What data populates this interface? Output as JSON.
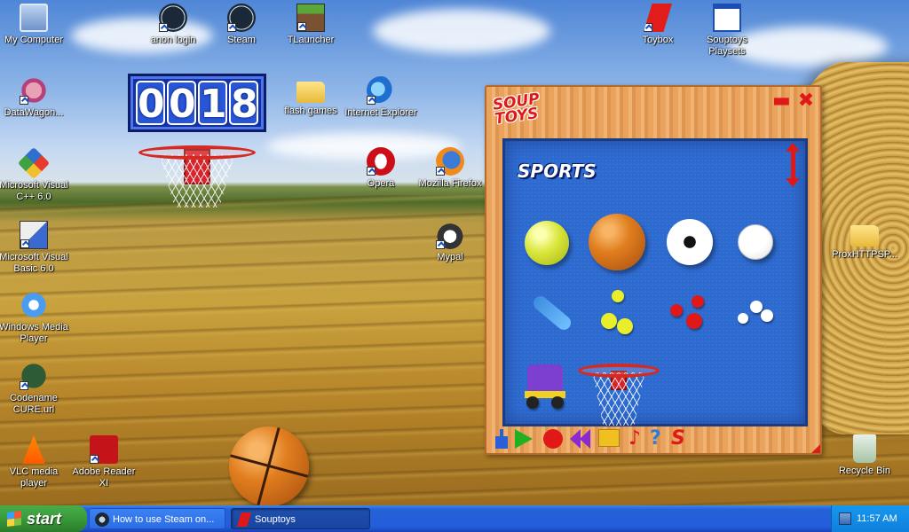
{
  "desktop": {
    "icons": [
      {
        "id": "my-computer",
        "label": "My Computer",
        "icon": "computer-icon"
      },
      {
        "id": "anon-login",
        "label": "anon login",
        "icon": "steam-icon"
      },
      {
        "id": "steam",
        "label": "Steam",
        "icon": "steam-icon"
      },
      {
        "id": "tlauncher",
        "label": "TLauncher",
        "icon": "minecraft-grass-icon"
      },
      {
        "id": "datawagon",
        "label": "DataWagon...",
        "icon": "datawagon-icon"
      },
      {
        "id": "flash-games",
        "label": "flash games",
        "icon": "folder-icon"
      },
      {
        "id": "internet-explorer",
        "label": "Internet Explorer",
        "icon": "internet-explorer-icon"
      },
      {
        "id": "visual-cpp",
        "label": "Microsoft Visual C++ 6.0",
        "icon": "visual-cpp-icon"
      },
      {
        "id": "opera",
        "label": "Opera",
        "icon": "opera-icon"
      },
      {
        "id": "firefox",
        "label": "Mozilla Firefox",
        "icon": "firefox-icon"
      },
      {
        "id": "visual-basic",
        "label": "Microsoft Visual Basic 6.0",
        "icon": "visual-basic-icon"
      },
      {
        "id": "mypal",
        "label": "Mypal",
        "icon": "mypal-icon"
      },
      {
        "id": "wmp",
        "label": "Windows Media Player",
        "icon": "media-player-icon"
      },
      {
        "id": "codename-cure",
        "label": "Codename CURE.url",
        "icon": "cure-icon"
      },
      {
        "id": "vlc",
        "label": "VLC media player",
        "icon": "vlc-cone-icon"
      },
      {
        "id": "adobe-reader",
        "label": "Adobe Reader XI",
        "icon": "adobe-reader-icon"
      },
      {
        "id": "toybox",
        "label": "Toybox",
        "icon": "souptoys-s-icon"
      },
      {
        "id": "souptoys-playsets",
        "label": "Souptoys Playsets",
        "icon": "window-icon"
      },
      {
        "id": "proxhttpsp",
        "label": "ProxHTTPSP...",
        "icon": "folder-icon"
      },
      {
        "id": "recycle-bin",
        "label": "Recycle Bin",
        "icon": "recycle-bin-icon"
      }
    ],
    "scoreboard_digits": [
      "0",
      "0",
      "1",
      "8"
    ]
  },
  "souptoys_window": {
    "logo": "SOUP TOYS",
    "minimize_symbol": "▬",
    "close_symbol": "✖",
    "category": "SPORTS",
    "toys": [
      {
        "name": "tennis-ball",
        "icon": "tennis-ball-icon"
      },
      {
        "name": "basketball",
        "icon": "basketball-icon"
      },
      {
        "name": "soccer-ball",
        "icon": "soccer-ball-icon"
      },
      {
        "name": "baseball",
        "icon": "baseball-icon"
      },
      {
        "name": "bat",
        "icon": "bat-icon"
      },
      {
        "name": "yellow-balls",
        "icon": "yellow-balls-icon"
      },
      {
        "name": "red-balls",
        "icon": "red-balls-icon"
      },
      {
        "name": "white-balls",
        "icon": "white-balls-icon"
      },
      {
        "name": "roller-skate",
        "icon": "roller-skate-icon"
      },
      {
        "name": "basketball-hoop",
        "icon": "basketball-hoop-icon"
      }
    ],
    "toolbar": [
      {
        "name": "blue-tool",
        "icon": "blue-jack-icon"
      },
      {
        "name": "play",
        "icon": "play-icon"
      },
      {
        "name": "record",
        "icon": "record-icon"
      },
      {
        "name": "rewind",
        "icon": "rewind-icon"
      },
      {
        "name": "yellow-square",
        "icon": "yellow-square-icon"
      },
      {
        "name": "music",
        "icon": "music-note-icon",
        "symbol": "♪"
      },
      {
        "name": "help",
        "icon": "help-icon",
        "symbol": "?"
      },
      {
        "name": "souptoys-menu",
        "icon": "souptoys-s-icon",
        "symbol": "S"
      }
    ]
  },
  "taskbar": {
    "start_label": "start",
    "tasks": [
      {
        "label": "How to use Steam on...",
        "icon": "steam-icon",
        "active": false
      },
      {
        "label": "Souptoys",
        "icon": "souptoys-s-icon",
        "active": true
      }
    ],
    "clock": "11:57 AM"
  },
  "colors": {
    "taskbar_blue": "#245ddb",
    "start_green": "#3a9a3a",
    "souptoys_red": "#e01818",
    "panel_blue": "#2d6ad0",
    "scoreboard_blue": "#1130a8"
  }
}
